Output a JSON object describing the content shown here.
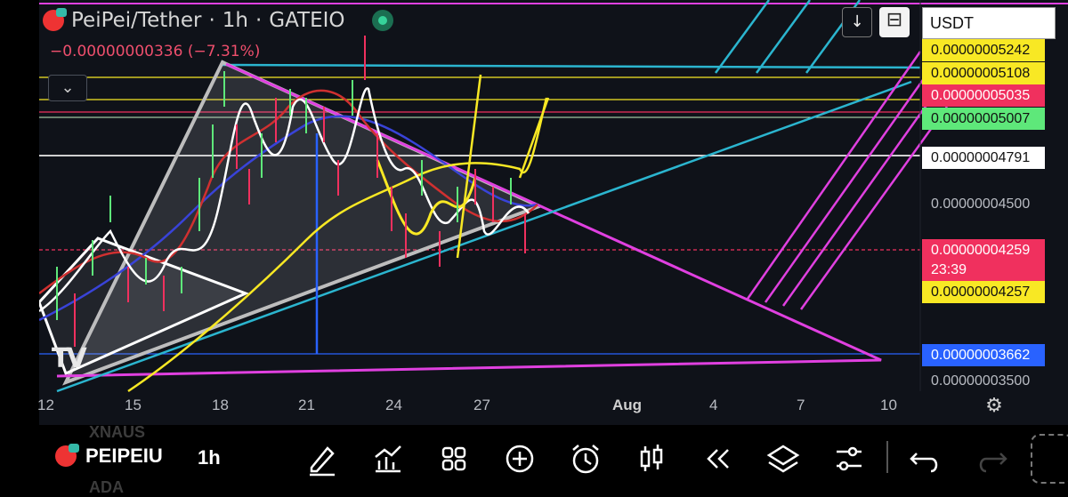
{
  "header": {
    "pair": "PeiPei/Tether",
    "interval": "1h",
    "exchange": "GATEIO",
    "change": "−0.00000000336 (−7.31%)"
  },
  "controls": {
    "collapse_icon": "chevron-down-icon",
    "download_icon": "arrow-down-icon",
    "snapshot_icon": "snapshot-icon",
    "currency": "USDT"
  },
  "price_axis": {
    "labels": [
      {
        "text": "0.00000005242",
        "bg": "#f8e824",
        "fg": "#111111"
      },
      {
        "text": "0.00000005108",
        "bg": "#f8e824",
        "fg": "#111111"
      },
      {
        "text": "0.00000005035",
        "bg": "#f0305e",
        "fg": "#ffffff"
      },
      {
        "text": "0.00000005007",
        "bg": "#5ee87a",
        "fg": "#111111"
      },
      {
        "text": "0.00000004791",
        "bg": "#ffffff",
        "fg": "#111111"
      },
      {
        "text": "0.00000004500",
        "bg": "",
        "fg": "#b9bcc3"
      },
      {
        "text": "0.00000004259",
        "bg": "#f0305e",
        "fg": "#ffffff"
      },
      {
        "text": "23:39",
        "bg": "#f0305e",
        "fg": "#ffffff"
      },
      {
        "text": "0.00000004257",
        "bg": "#f8e824",
        "fg": "#111111"
      },
      {
        "text": "0.00000003662",
        "bg": "#2962ff",
        "fg": "#ffffff"
      },
      {
        "text": "0.00000003500",
        "bg": "",
        "fg": "#b9bcc3"
      }
    ]
  },
  "time_axis": {
    "ticks": [
      "12",
      "15",
      "18",
      "21",
      "24",
      "27",
      "Aug",
      "4",
      "7",
      "10"
    ]
  },
  "watermark": "TV",
  "toolbar": {
    "symbol": "PEIPEIU",
    "interval": "1h",
    "ghost_above": "XNAUS",
    "ghost_below": "ADA",
    "icons": [
      "pencil-icon",
      "indicators-icon",
      "grid-icon",
      "plus-circle-icon",
      "alarm-icon",
      "candles-icon",
      "replay-icon",
      "layers-icon",
      "settings-sliders-icon",
      "undo-icon",
      "redo-icon"
    ]
  },
  "colors": {
    "background": "#0f1219",
    "magenta": "#e040e0",
    "cyan": "#2bb5cf",
    "yellow": "#f8e824",
    "negative": "#ef4f6d"
  }
}
